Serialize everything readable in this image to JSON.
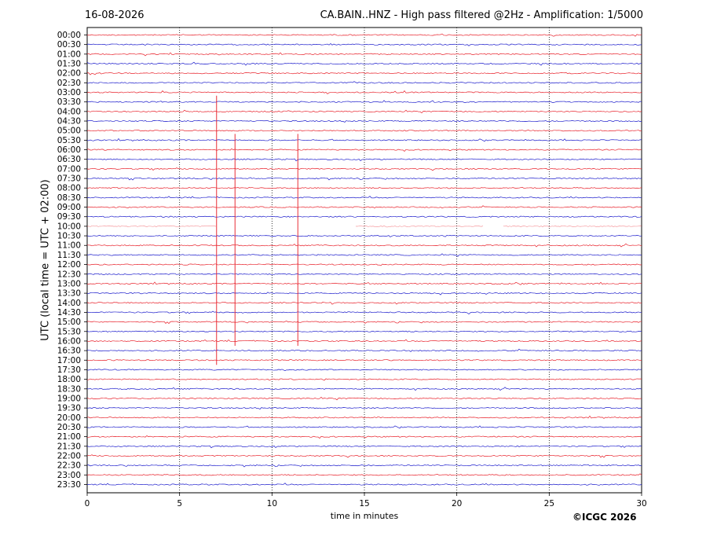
{
  "header": {
    "date": "16-08-2026",
    "title": "CA.BAIN..HNZ - High pass filtered @2Hz - Amplification: 1/5000"
  },
  "credit": "©ICGC 2026",
  "colors": {
    "red": "#e8202a",
    "blue": "#1c1ccc",
    "grid": "#000000"
  },
  "chart_data": {
    "type": "line",
    "title": "CA.BAIN..HNZ - High pass filtered @2Hz - Amplification: 1/5000",
    "xlabel": "time in minutes",
    "ylabel": "UTC (local time = UTC + 02:00)",
    "xlim": [
      0,
      30
    ],
    "xticks": [
      0,
      5,
      10,
      15,
      20,
      25,
      30
    ],
    "grid": "vertical dotted lines at x = 5, 10, 15, 20, 25",
    "trace_labels": [
      "00:00",
      "00:30",
      "01:00",
      "01:30",
      "02:00",
      "02:30",
      "03:00",
      "03:30",
      "04:00",
      "04:30",
      "05:00",
      "05:30",
      "06:00",
      "06:30",
      "07:00",
      "07:30",
      "08:00",
      "08:30",
      "09:00",
      "09:30",
      "10:00",
      "10:30",
      "11:00",
      "11:30",
      "12:00",
      "12:30",
      "13:00",
      "13:30",
      "14:00",
      "14:30",
      "15:00",
      "15:30",
      "16:00",
      "16:30",
      "17:00",
      "17:30",
      "18:00",
      "18:30",
      "19:00",
      "19:30",
      "20:00",
      "20:30",
      "21:00",
      "21:30",
      "22:00",
      "22:30",
      "23:00",
      "23:30"
    ],
    "trace_colors": "alternating red (on the hour) and blue (half hour)",
    "events": [
      {
        "x": 7.0,
        "from": "03:30",
        "to": "17:00"
      },
      {
        "x": 8.0,
        "from": "05:30",
        "to": "16:00"
      },
      {
        "x": 11.4,
        "from": "05:30",
        "to": "16:00"
      }
    ],
    "gaps": [
      {
        "trace": "10:00",
        "from_min": 7.0,
        "to_min": 14.5
      },
      {
        "trace": "10:00",
        "from_min": 21.5,
        "to_min": 22.5
      }
    ]
  }
}
